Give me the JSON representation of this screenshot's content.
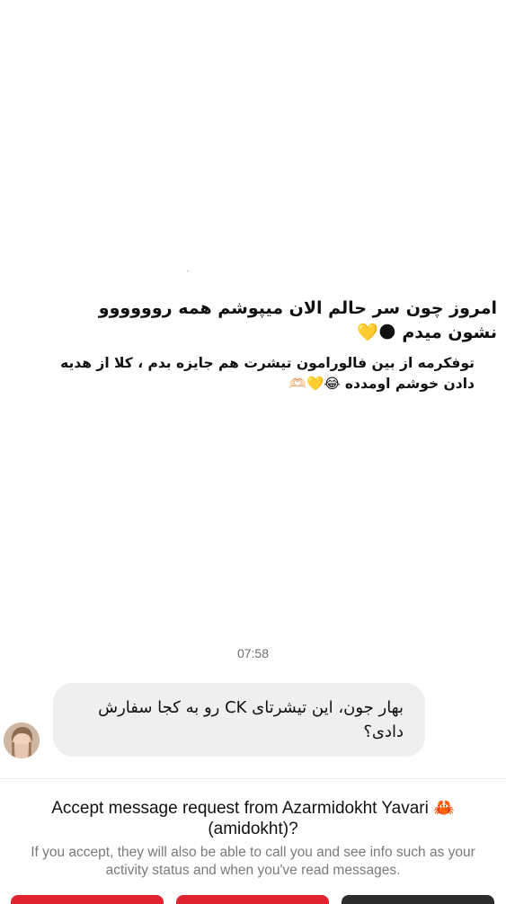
{
  "story": {
    "line1": "امروز چون سر حالم الان میپوشم همه روووووو نشون میدم 🌑💛",
    "line2": "توفکرمه از بین فالورامون تیشرت هم جایزه بدم ، کلا از هدیه دادن خوشم اومدده 😂💛🫶🏻"
  },
  "timestamp": "07:58",
  "message": {
    "text": "بهار جون، این تیشرتای CK رو به کجا سفارش دادی؟"
  },
  "request": {
    "title": "Accept message request from Azarmidokht Yavari 🦀 (amidokht)?",
    "subtitle": "If you accept, they will also be able to call you and see info such as your activity status and when you've read messages."
  },
  "colors": {
    "bubble_bg": "#efefef",
    "danger": "#e0242f",
    "primary_dark": "#2c2c2c",
    "secondary_text": "#7a7a7a"
  },
  "icons": {
    "avatar": "profile-photo",
    "crab": "crab-emoji"
  }
}
